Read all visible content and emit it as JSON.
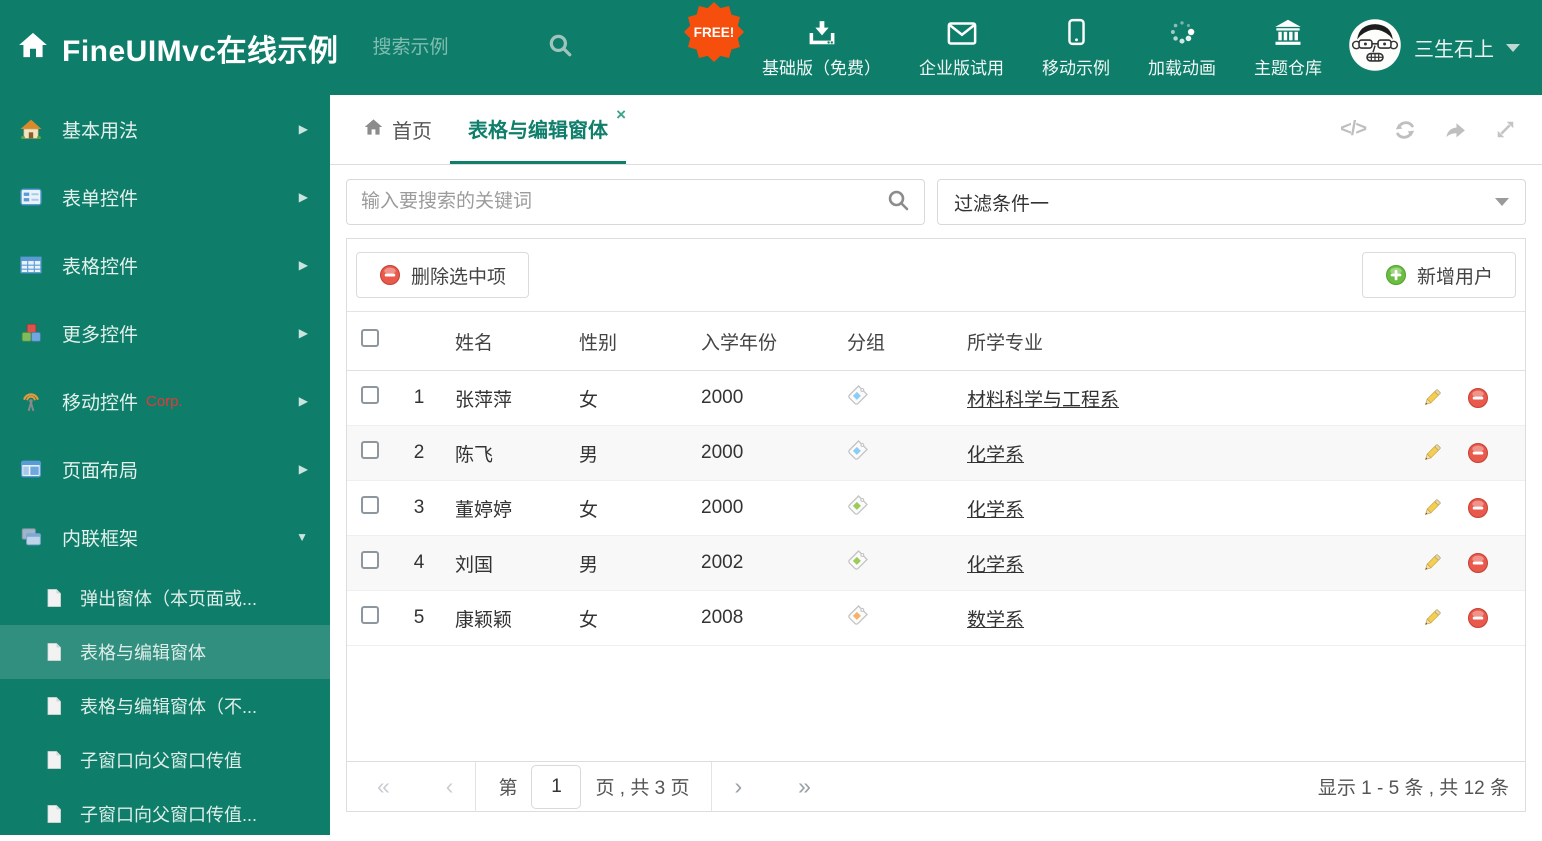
{
  "colors": {
    "brand_teal": "#0E7D6A",
    "active_tab": "#0F7E6B",
    "free_badge": "#F64E0C",
    "delete_red": "#E9594C",
    "add_green": "#6CBE43",
    "corp_red": "#E53935"
  },
  "icons": {
    "brand": "home-icon",
    "header_search": "search-icon",
    "user_menu": "caret-down-icon",
    "tab_home": "home-icon",
    "tab_close": "close-icon",
    "tab_actions": [
      "code-icon",
      "refresh-icon",
      "forward-icon",
      "expand-icon"
    ],
    "row_actions": [
      "pencil-edit-icon",
      "minus-delete-icon"
    ],
    "group_cell": "tag-icon"
  },
  "header": {
    "title": "FineUIMvc在线示例",
    "search_placeholder": "搜索示例",
    "free_badge": "FREE!",
    "nav": [
      {
        "label": "基础版（免费）",
        "icon": "download-icon"
      },
      {
        "label": "企业版试用",
        "icon": "envelope-icon"
      },
      {
        "label": "移动示例",
        "icon": "mobile-icon"
      },
      {
        "label": "加载动画",
        "icon": "spinner-icon"
      },
      {
        "label": "主题仓库",
        "icon": "bank-icon"
      }
    ],
    "user_name": "三生石上"
  },
  "sidebar": {
    "items": [
      {
        "label": "基本用法",
        "icon": "home-icon",
        "arrow": "▶"
      },
      {
        "label": "表单控件",
        "icon": "form-icon",
        "arrow": "▶"
      },
      {
        "label": "表格控件",
        "icon": "table-icon",
        "arrow": "▶"
      },
      {
        "label": "更多控件",
        "icon": "cubes-icon",
        "arrow": "▶"
      },
      {
        "label": "移动控件",
        "icon": "antenna-icon",
        "badge": "Corp.",
        "arrow": "▶"
      },
      {
        "label": "页面布局",
        "icon": "layout-icon",
        "arrow": "▶"
      },
      {
        "label": "内联框架",
        "icon": "frames-icon",
        "arrow": "▼"
      }
    ],
    "subitems": [
      {
        "label": "弹出窗体（本页面或..."
      },
      {
        "label": "表格与编辑窗体",
        "active": true
      },
      {
        "label": "表格与编辑窗体（不..."
      },
      {
        "label": "子窗口向父窗口传值"
      },
      {
        "label": "子窗口向父窗口传值..."
      }
    ]
  },
  "tabs": {
    "home": "首页",
    "active_tab": "表格与编辑窗体",
    "close_glyph": "×"
  },
  "filters": {
    "keyword_placeholder": "输入要搜索的关键词",
    "filter_selected": "过滤条件一"
  },
  "toolbar": {
    "delete_label": "删除选中项",
    "add_label": "新增用户"
  },
  "table": {
    "columns": {
      "name": "姓名",
      "gender": "性别",
      "year": "入学年份",
      "group": "分组",
      "major": "所学专业"
    },
    "rows": [
      {
        "index": "1",
        "name": "张萍萍",
        "gender": "女",
        "year": "2000",
        "tag_color": "#8CCDF5",
        "major": "材料科学与工程系"
      },
      {
        "index": "2",
        "name": "陈飞",
        "gender": "男",
        "year": "2000",
        "tag_color": "#8CCDF5",
        "major": "化学系"
      },
      {
        "index": "3",
        "name": "董婷婷",
        "gender": "女",
        "year": "2000",
        "tag_color": "#9CCB5A",
        "major": "化学系"
      },
      {
        "index": "4",
        "name": "刘国",
        "gender": "男",
        "year": "2002",
        "tag_color": "#9CCB5A",
        "major": "化学系"
      },
      {
        "index": "5",
        "name": "康颖颖",
        "gender": "女",
        "year": "2008",
        "tag_color": "#F6B26B",
        "major": "数学系"
      }
    ]
  },
  "pagination": {
    "first": "«",
    "prev": "‹",
    "next": "›",
    "last": "»",
    "page_label_before": "第",
    "page_value": "1",
    "page_label_after": "页 , 共 3 页",
    "summary": "显示 1 - 5 条 , 共 12 条"
  }
}
